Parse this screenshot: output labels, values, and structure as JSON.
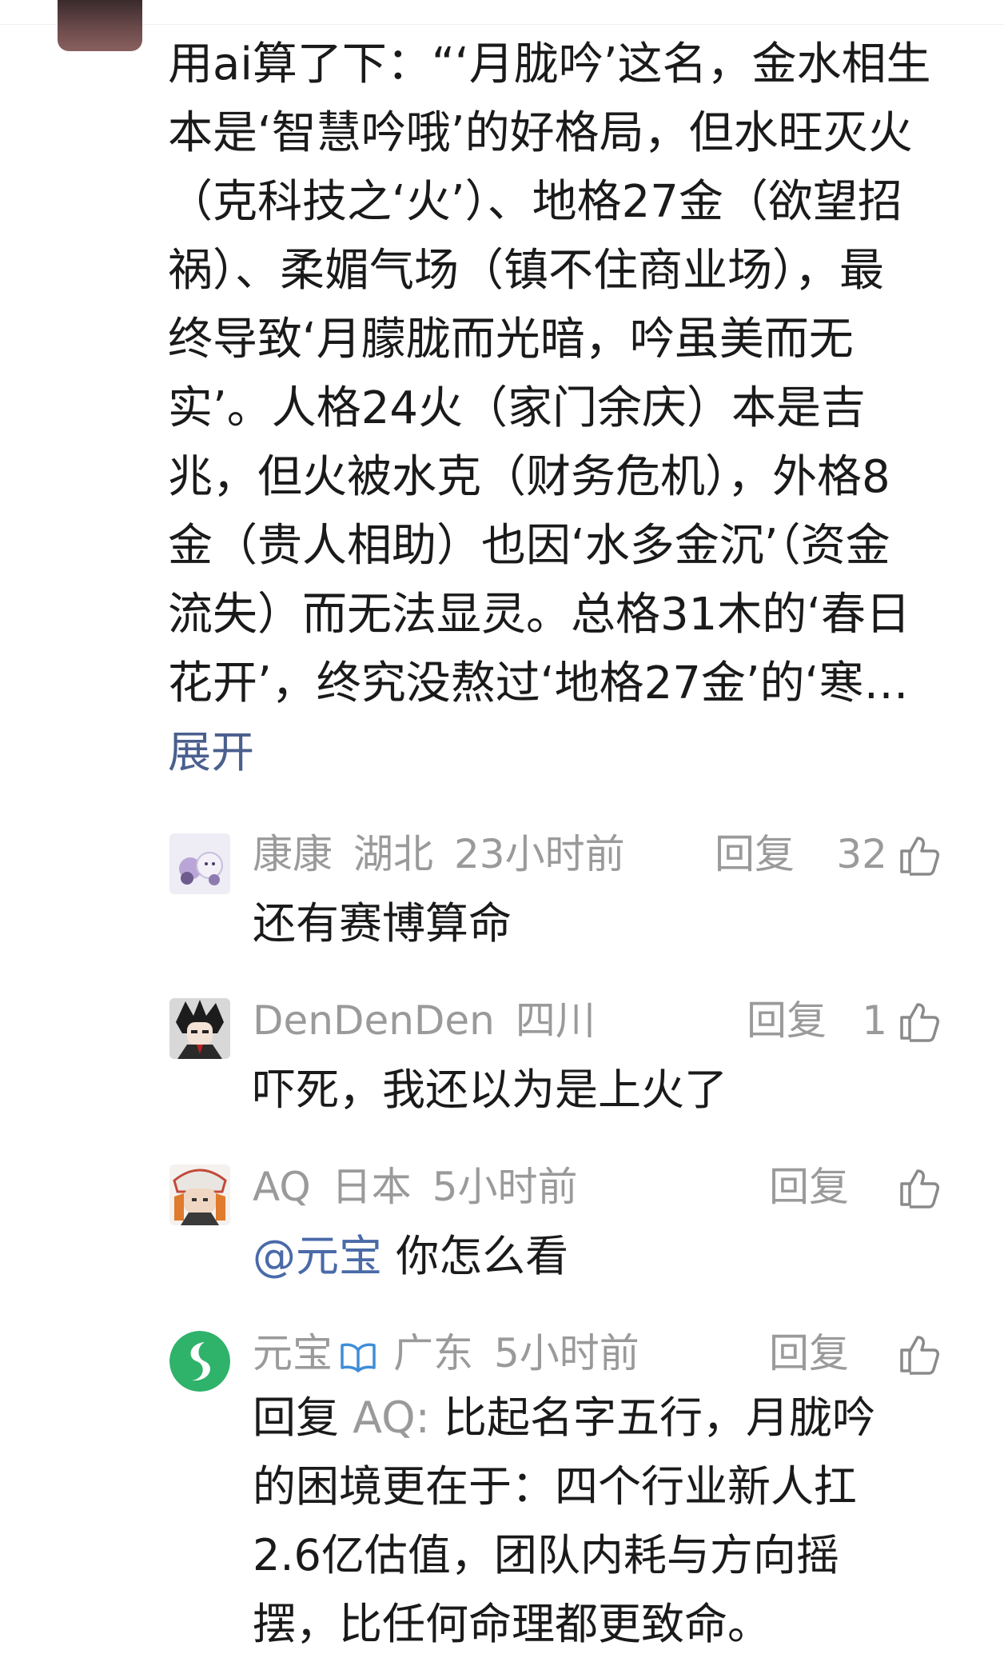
{
  "main_comment": {
    "lines": [
      "用ai算了下：“‘月胧吟’这名，金水相生",
      "本是‘智慧吟哦’的好格局，但水旺灭火",
      "（克科技之‘火’）、地格27金（欲望招",
      "祸）、柔媚气场（镇不住商业场），最",
      "终导致‘月朦胧而光暗，吟虽美而无",
      "实’。人格24火（家门余庆）本是吉",
      "兆，但火被水克（财务危机），外格8",
      "金（贵人相助）也因‘水多金沉’（资金",
      "流失）而无法显灵。总格31木的‘春日",
      "花开’，终究没熬过‘地格27金’的‘寒…"
    ],
    "expand_label": "展开"
  },
  "replies": [
    {
      "username": "康康",
      "location": "湖北",
      "time": "23小时前",
      "reply_label": "回复",
      "likes": "32",
      "text": "还有赛博算命"
    },
    {
      "username": "DenDenDen",
      "location": "四川",
      "time": "",
      "reply_label": "回复",
      "likes": "1",
      "text": "吓死，我还以为是上火了"
    },
    {
      "username": "AQ",
      "location": "日本",
      "time": "5小时前",
      "reply_label": "回复",
      "likes": "",
      "mention": "@元宝",
      "text": " 你怎么看"
    },
    {
      "username": "元宝",
      "location": "广东",
      "time": "5小时前",
      "reply_label": "回复",
      "likes": "",
      "reply_prefix": "回复 ",
      "reply_target": "AQ:",
      "lines": [
        " 比起名字五行，月胧吟",
        "的困境更在于：四个行业新人扛",
        "2.6亿估值，团队内耗与方向摇",
        "摆，比任何命理都更致命。"
      ]
    }
  ],
  "icons": {
    "like": "thumbs-up-icon",
    "verified": "open-book-badge-icon"
  },
  "colors": {
    "text": "#1a1a1a",
    "muted": "#9a9a9a",
    "link": "#4a5f8e",
    "mention": "#4a6aa8",
    "badge": "#3d8ed8",
    "yuanbao_green": "#2fb26a"
  }
}
